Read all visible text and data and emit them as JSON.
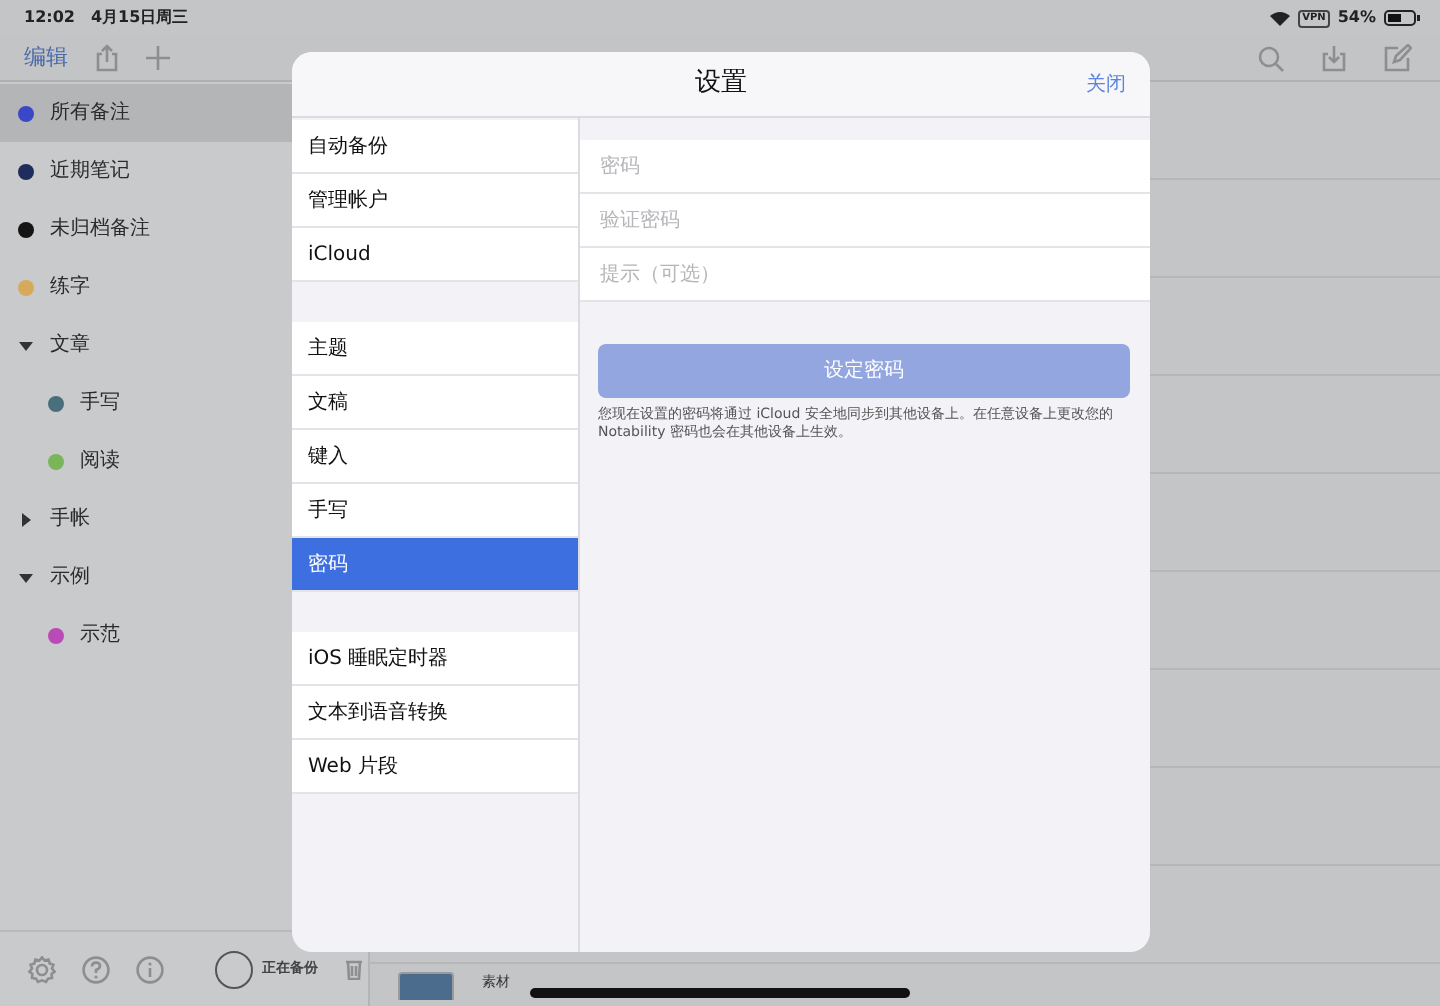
{
  "status_bar": {
    "time": "12:02",
    "date": "4月15日周三",
    "vpn": "VPN",
    "battery": "54%"
  },
  "toolbar": {
    "edit": "编辑"
  },
  "sidebar": {
    "items": [
      {
        "label": "所有备注",
        "kind": "dot",
        "color": "#3a48c8",
        "selected": true
      },
      {
        "label": "近期笔记",
        "kind": "dot",
        "color": "#1f2d5c",
        "selected": false
      },
      {
        "label": "未归档备注",
        "kind": "dot",
        "color": "#151515",
        "selected": false
      },
      {
        "label": "练字",
        "kind": "dot",
        "color": "#d6aa5a",
        "selected": false
      },
      {
        "label": "文章",
        "kind": "folder",
        "expanded": true,
        "selected": false,
        "children": [
          {
            "label": "手写",
            "kind": "dot",
            "color": "#4a6f7c",
            "selected": false
          },
          {
            "label": "阅读",
            "kind": "dot",
            "color": "#7bb55a",
            "selected": false
          }
        ]
      },
      {
        "label": "手帐",
        "kind": "folder",
        "expanded": false,
        "selected": false
      },
      {
        "label": "示例",
        "kind": "folder",
        "expanded": true,
        "selected": false,
        "children": [
          {
            "label": "示范",
            "kind": "dot",
            "color": "#b94bb6",
            "selected": false
          }
        ]
      }
    ],
    "backup_status": "正在备份"
  },
  "note_list": {
    "items": [
      {
        "title": "素材"
      }
    ]
  },
  "settings": {
    "title": "设置",
    "close": "关闭",
    "groups": [
      [
        {
          "label": "自动备份",
          "selected": false
        },
        {
          "label": "管理帐户",
          "selected": false
        },
        {
          "label": "iCloud",
          "selected": false
        }
      ],
      [
        {
          "label": "主题",
          "selected": false
        },
        {
          "label": "文稿",
          "selected": false
        },
        {
          "label": "键入",
          "selected": false
        },
        {
          "label": "手写",
          "selected": false
        },
        {
          "label": "密码",
          "selected": true
        }
      ],
      [
        {
          "label": "iOS 睡眠定时器",
          "selected": false
        },
        {
          "label": "文本到语音转换",
          "selected": false
        },
        {
          "label": "Web 片段",
          "selected": false
        }
      ]
    ],
    "form": {
      "fields": [
        {
          "placeholder": "密码"
        },
        {
          "placeholder": "验证密码"
        },
        {
          "placeholder": "提示（可选）"
        }
      ],
      "button": {
        "label": "设定密码",
        "disabled": true
      },
      "note": "您现在设置的密码将通过 iCloud 安全地同步到其他设备上。在任意设备上更改您的 Notability 密码也会在其他设备上生效。"
    }
  }
}
